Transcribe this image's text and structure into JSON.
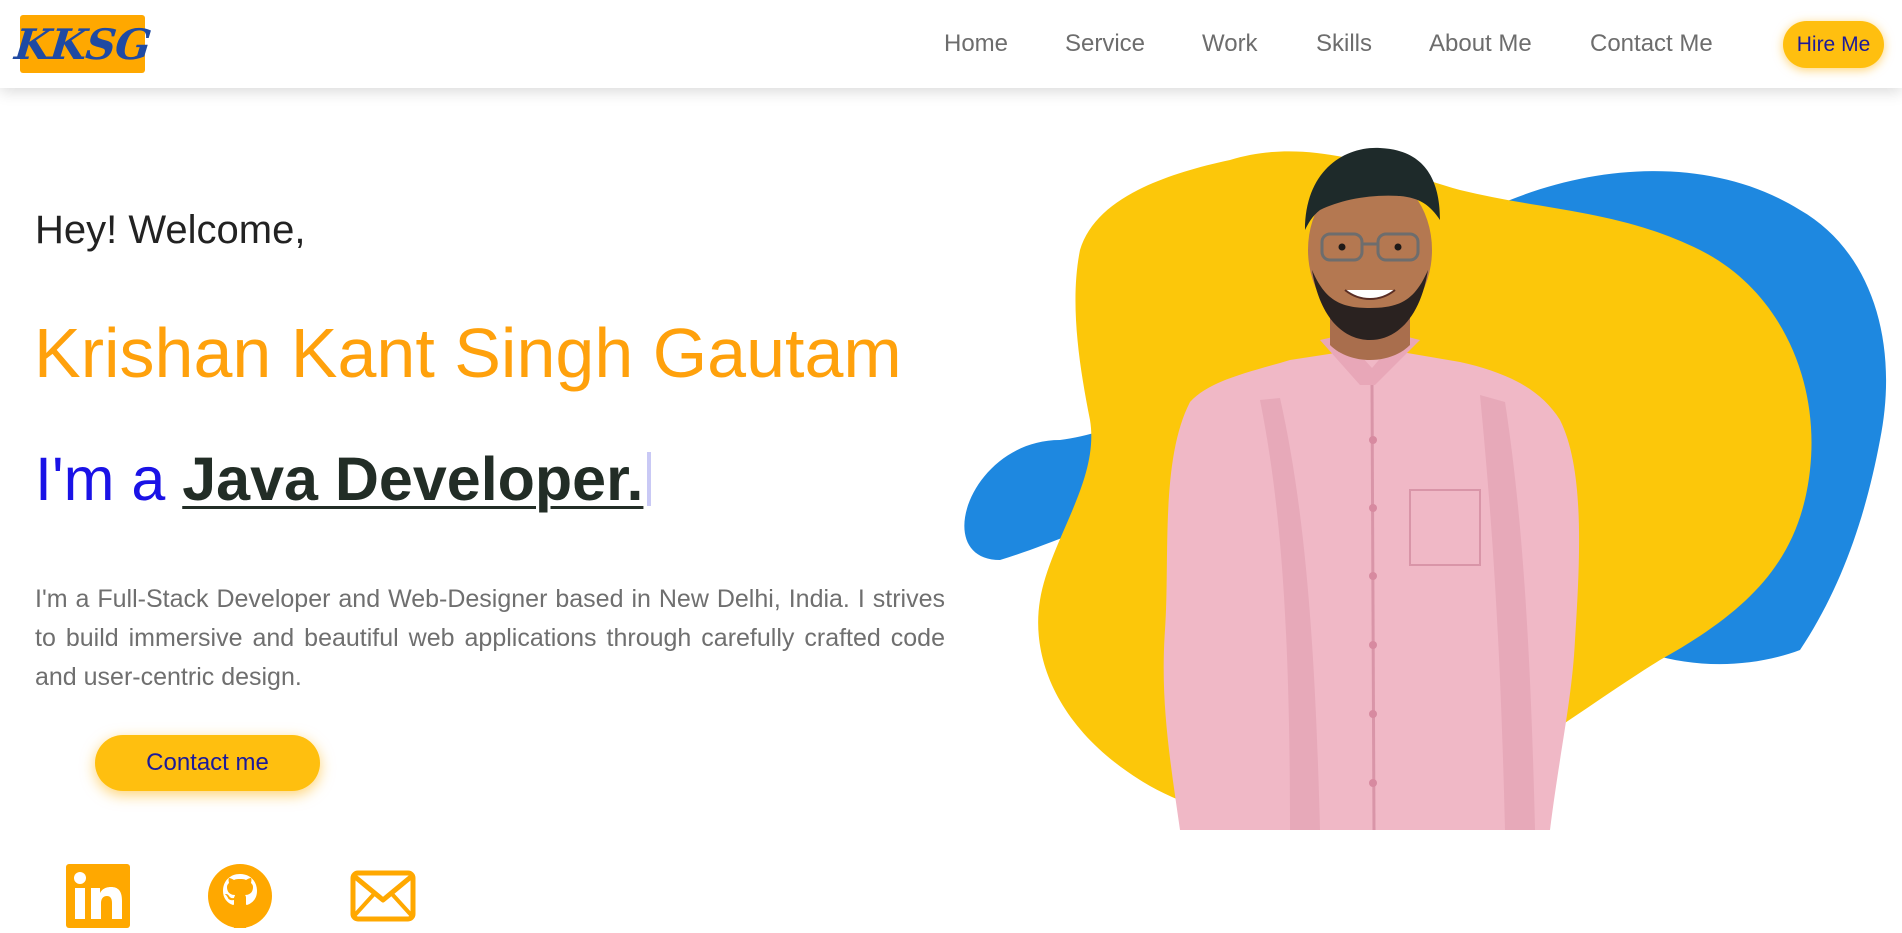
{
  "logo": {
    "text": "KKSG"
  },
  "nav": {
    "items": [
      {
        "label": "Home"
      },
      {
        "label": "Service"
      },
      {
        "label": "Work"
      },
      {
        "label": "Skills"
      },
      {
        "label": "About Me"
      },
      {
        "label": "Contact Me"
      }
    ],
    "hire_label": "Hire Me"
  },
  "hero": {
    "greeting": "Hey! Welcome,",
    "name": "Krishan Kant Singh Gautam",
    "role_prefix": "I'm a",
    "role_typed": "Java Developer.",
    "bio": "I'm a Full-Stack Developer and Web-Designer based in New Delhi, India. I strives to build immersive and beautiful web applications through carefully crafted code and user-centric design.",
    "contact_label": "Contact me"
  },
  "social": [
    {
      "icon": "linkedin-icon"
    },
    {
      "icon": "github-icon"
    },
    {
      "icon": "mail-icon"
    }
  ],
  "colors": {
    "accent": "#ffa10c",
    "button": "#ffbf0f",
    "blob_yellow": "#fcc70a",
    "blob_blue": "#1e88e0",
    "role_prefix": "#1a12e6",
    "button_text": "#1b1a9a"
  }
}
